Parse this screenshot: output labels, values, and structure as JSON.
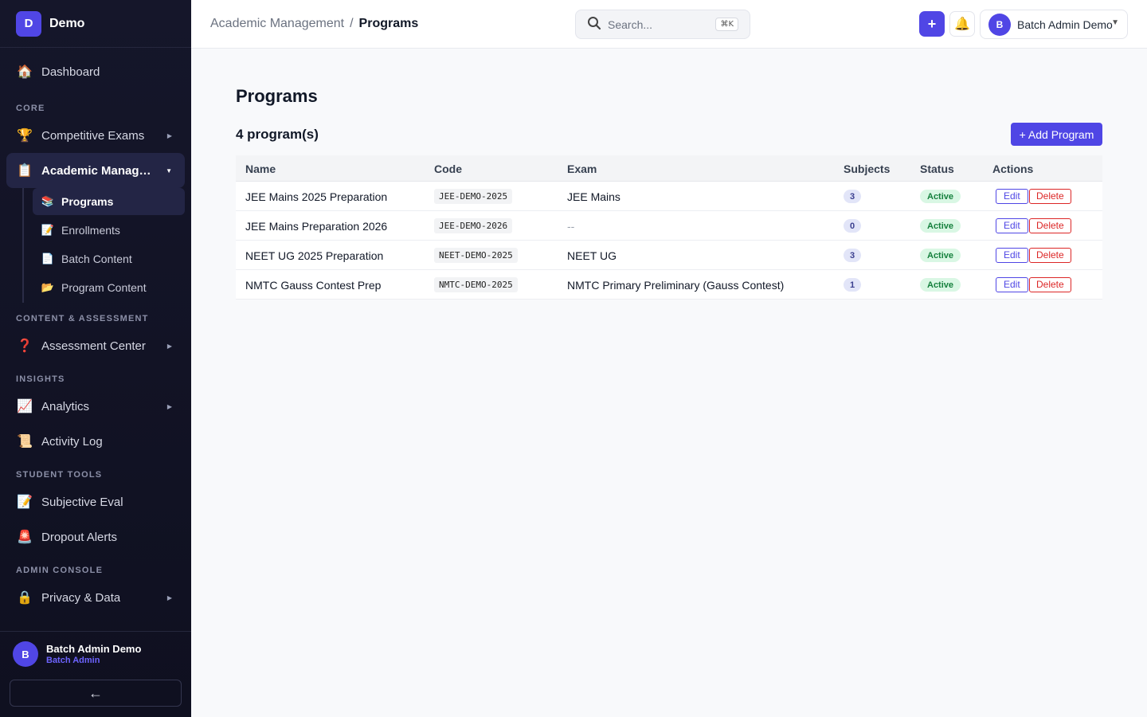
{
  "brand": {
    "logo_letter": "D",
    "name": "Demo"
  },
  "sidebar": {
    "dashboard": {
      "label": "Dashboard",
      "icon": "house-icon"
    },
    "sections": {
      "core": "CORE",
      "content": "CONTENT & ASSESSMENT",
      "insights": "INSIGHTS",
      "student_tools": "STUDENT TOOLS",
      "admin": "ADMIN CONSOLE"
    },
    "competitive_exams": {
      "label": "Competitive Exams",
      "icon": "trophy-icon"
    },
    "academic_management": {
      "label": "Academic Management",
      "icon": "clipboard-icon"
    },
    "sub_items": [
      {
        "label": "Programs",
        "icon": "books-icon"
      },
      {
        "label": "Enrollments",
        "icon": "memo-icon"
      },
      {
        "label": "Batch Content",
        "icon": "page-icon"
      },
      {
        "label": "Program Content",
        "icon": "folder-icon"
      }
    ],
    "assessment_center": {
      "label": "Assessment Center",
      "icon": "question-icon"
    },
    "analytics": {
      "label": "Analytics",
      "icon": "chart-icon"
    },
    "activity_log": {
      "label": "Activity Log",
      "icon": "scroll-icon"
    },
    "subjective_eval": {
      "label": "Subjective Eval",
      "icon": "memo-icon"
    },
    "dropout_alerts": {
      "label": "Dropout Alerts",
      "icon": "siren-icon"
    },
    "privacy": {
      "label": "Privacy & Data",
      "icon": "lock-icon"
    },
    "footer": {
      "avatar_letter": "B",
      "user_name": "Batch Admin Demo",
      "user_role": "Batch Admin",
      "collapse_label": "←"
    }
  },
  "topbar": {
    "breadcrumb_parent": "Academic Management",
    "breadcrumb_sep": "/",
    "breadcrumb_current": "Programs",
    "search_placeholder": "Search...",
    "search_shortcut": "⌘K",
    "plus_label": "+",
    "user_avatar_letter": "B",
    "user_name": "Batch Admin Demo"
  },
  "main": {
    "title": "Programs",
    "count_label": "4 program(s)",
    "add_button": "+ Add Program",
    "columns": [
      "Name",
      "Code",
      "Exam",
      "Subjects",
      "Status",
      "Actions"
    ],
    "rows": [
      {
        "name": "JEE Mains 2025 Preparation",
        "code": "JEE-DEMO-2025",
        "exam": "JEE Mains",
        "subjects": "3",
        "status": "Active",
        "edit": "Edit",
        "delete": "Delete"
      },
      {
        "name": "JEE Mains Preparation 2026",
        "code": "JEE-DEMO-2026",
        "exam": "--",
        "subjects": "0",
        "status": "Active",
        "edit": "Edit",
        "delete": "Delete"
      },
      {
        "name": "NEET UG 2025 Preparation",
        "code": "NEET-DEMO-2025",
        "exam": "NEET UG",
        "subjects": "3",
        "status": "Active",
        "edit": "Edit",
        "delete": "Delete"
      },
      {
        "name": "NMTC Gauss Contest Prep",
        "code": "NMTC-DEMO-2025",
        "exam": "NMTC Primary Preliminary (Gauss Contest)",
        "subjects": "1",
        "status": "Active",
        "edit": "Edit",
        "delete": "Delete"
      }
    ]
  },
  "colors": {
    "accent": "#4f46e5",
    "sidebar_bg": "#15162a",
    "active_status_bg": "#d9f7e4",
    "active_status_text": "#15803d",
    "danger": "#dc2626"
  }
}
